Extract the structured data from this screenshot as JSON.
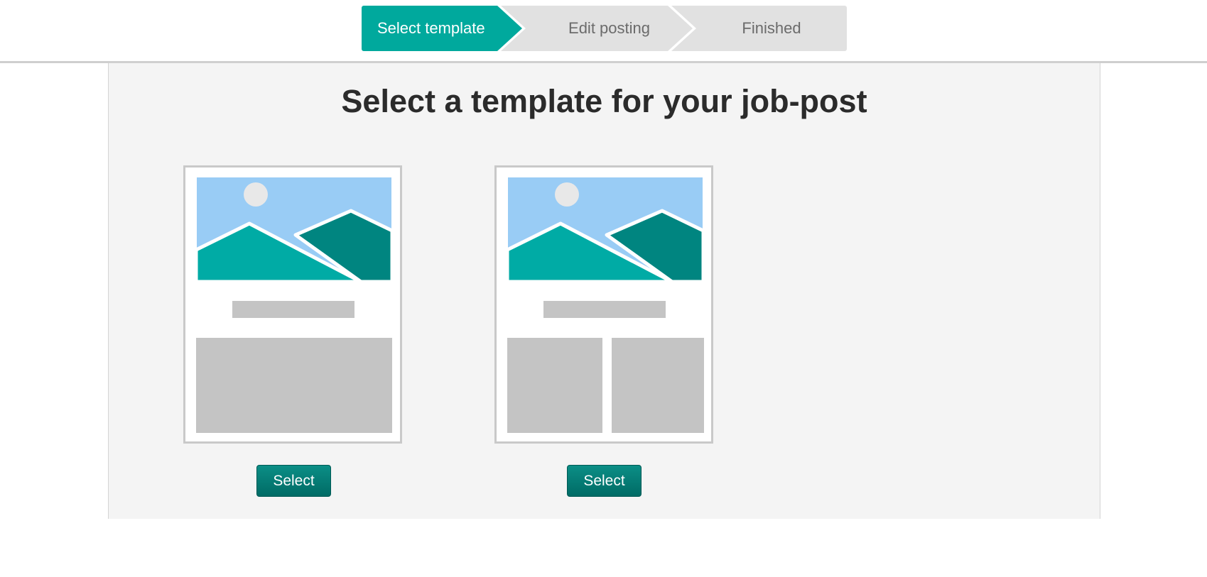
{
  "stepper": {
    "steps": [
      {
        "label": "Select template",
        "active": true
      },
      {
        "label": "Edit posting",
        "active": false
      },
      {
        "label": "Finished",
        "active": false
      }
    ]
  },
  "main": {
    "title": "Select a template for your job-post",
    "templates": [
      {
        "layout": "single-column",
        "button_label": "Select"
      },
      {
        "layout": "two-column",
        "button_label": "Select"
      }
    ]
  },
  "colors": {
    "accent": "#00a99d",
    "button": "#007d76",
    "sky": "#99ccf5",
    "mountain_light": "#00aba5",
    "mountain_dark": "#008580",
    "placeholder": "#c4c4c4",
    "background": "#f4f4f4"
  }
}
